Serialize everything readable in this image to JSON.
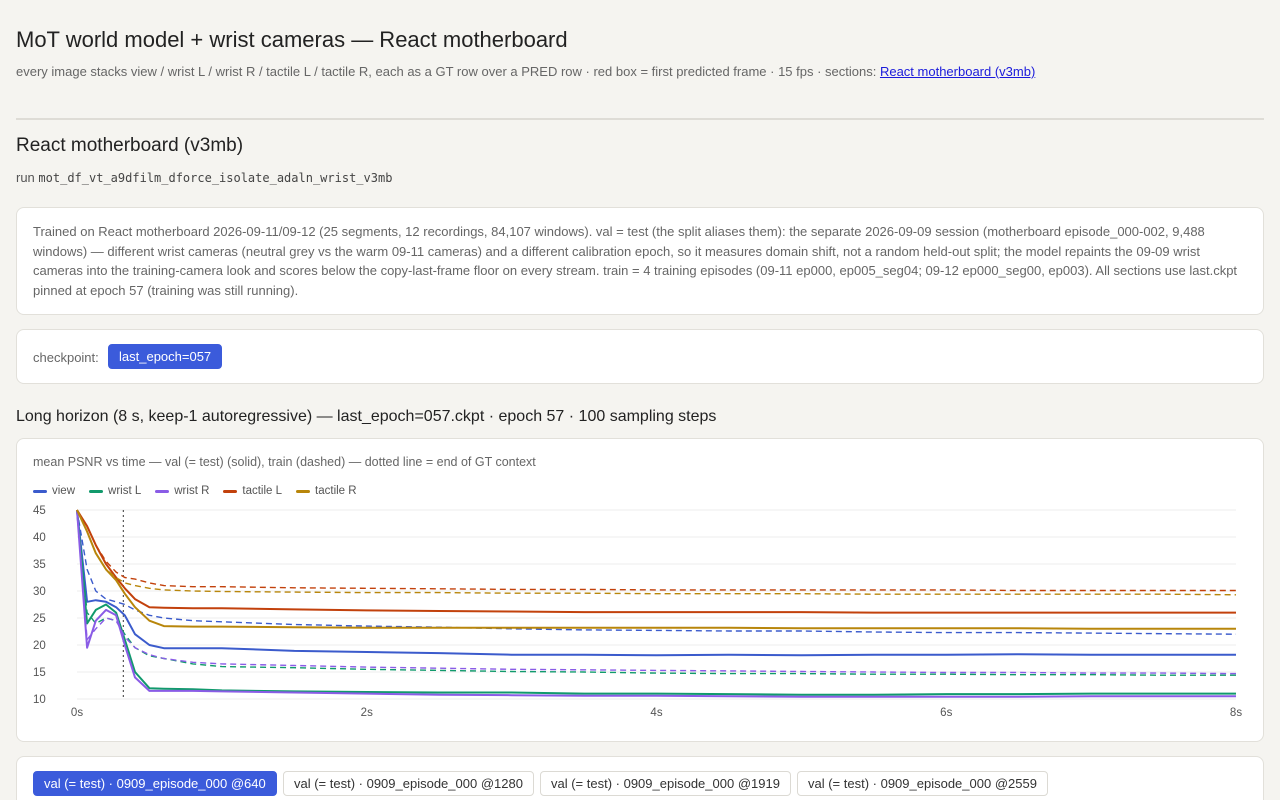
{
  "header": {
    "title": "MoT world model + wrist cameras — React motherboard",
    "subtitle_prefix": "every image stacks view / wrist L / wrist R / tactile L / tactile R, each as a GT row over a PRED row · red box = first predicted frame · 15 fps · sections: ",
    "sections_link": "React motherboard (v3mb)"
  },
  "section": {
    "title": "React motherboard (v3mb)",
    "run_prefix": "run",
    "run_name": "mot_df_vt_a9dfilm_dforce_isolate_adaln_wrist_v3mb",
    "description": "Trained on React motherboard 2026-09-11/09-12 (25 segments, 12 recordings, 84,107 windows). val = test (the split aliases them): the separate 2026-09-09 session (motherboard episode_000-002, 9,488 windows) — different wrist cameras (neutral grey vs the warm 09-11 cameras) and a different calibration epoch, so it measures domain shift, not a random held-out split; the model repaints the 09-09 wrist cameras into the training-camera look and scores below the copy-last-frame floor on every stream. train = 4 training episodes (09-11 ep000, ep005_seg04; 09-12 ep000_seg00, ep003). All sections use last.ckpt pinned at epoch 57 (training was still running).",
    "checkpoint_label": "checkpoint:",
    "checkpoint_value": "last_epoch=057",
    "horizon_title": "Long horizon (8 s, keep-1 autoregressive) — last_epoch=057.ckpt · epoch 57 · 100 sampling steps"
  },
  "chart_title": "mean PSNR vs time — val (= test) (solid), train (dashed) — dotted line = end of GT context",
  "chart_data": {
    "type": "line",
    "title": "mean PSNR vs time — val (= test) (solid), train (dashed) — dotted line = end of GT context",
    "xlabel": "",
    "ylabel": "",
    "xlim": [
      0,
      8
    ],
    "ylim": [
      10,
      45
    ],
    "x_ticks": [
      "0s",
      "2s",
      "4s",
      "6s",
      "8s"
    ],
    "y_ticks": [
      10,
      15,
      20,
      25,
      30,
      35,
      40,
      45
    ],
    "context_end_s": 0.32,
    "grid": true,
    "legend_position": "top-left",
    "x": [
      0,
      0.07,
      0.13,
      0.2,
      0.27,
      0.33,
      0.4,
      0.5,
      0.6,
      0.8,
      1,
      1.5,
      2,
      2.5,
      3,
      3.5,
      4,
      4.5,
      5,
      5.5,
      6,
      6.5,
      7,
      7.5,
      8
    ],
    "series": [
      {
        "name": "view",
        "color": "#3b5bcc",
        "split": "val",
        "values": [
          45,
          28,
          28.3,
          28,
          27,
          25.5,
          22,
          20,
          19.4,
          19.4,
          19.4,
          18.9,
          18.7,
          18.5,
          18.2,
          18.2,
          18.1,
          18.2,
          18.1,
          18.2,
          18.2,
          18.3,
          18.2,
          18.2,
          18.2
        ]
      },
      {
        "name": "view",
        "color": "#3b5bcc",
        "split": "train",
        "values": [
          45,
          34,
          30,
          28.5,
          28,
          27.5,
          26.5,
          25.5,
          25,
          24.5,
          24.3,
          23.8,
          23.5,
          23.3,
          23,
          22.8,
          22.7,
          22.6,
          22.6,
          22.4,
          22.3,
          22.3,
          22.2,
          22.1,
          22
        ]
      },
      {
        "name": "wrist L",
        "color": "#119a6c",
        "split": "val",
        "values": [
          45,
          24,
          26.5,
          27.5,
          26,
          21,
          15,
          12,
          11.9,
          11.8,
          11.6,
          11.4,
          11.3,
          11.2,
          11.2,
          11,
          11,
          10.9,
          10.8,
          10.8,
          10.9,
          10.9,
          11,
          11,
          11
        ]
      },
      {
        "name": "wrist L",
        "color": "#119a6c",
        "split": "train",
        "values": [
          45,
          26,
          24,
          25,
          24.5,
          22,
          19.5,
          18,
          17.5,
          16.5,
          16,
          15.8,
          15.5,
          15.3,
          15.1,
          15,
          14.8,
          14.7,
          14.7,
          14.6,
          14.6,
          14.5,
          14.5,
          14.4,
          14.4
        ]
      },
      {
        "name": "wrist R",
        "color": "#8a5ce6",
        "split": "val",
        "values": [
          45,
          19.5,
          24.5,
          26.5,
          25.5,
          20,
          14,
          11.5,
          11.5,
          11.5,
          11.4,
          11.2,
          11,
          10.8,
          10.7,
          10.6,
          10.6,
          10.5,
          10.4,
          10.4,
          10.4,
          10.4,
          10.5,
          10.5,
          10.5
        ]
      },
      {
        "name": "wrist R",
        "color": "#8a5ce6",
        "split": "train",
        "values": [
          45,
          21,
          23,
          25,
          24.5,
          21.5,
          19.5,
          18.2,
          17.5,
          16.8,
          16.5,
          16.2,
          15.9,
          15.7,
          15.5,
          15.4,
          15.3,
          15.2,
          15.1,
          15,
          14.9,
          14.9,
          14.8,
          14.8,
          14.7
        ]
      },
      {
        "name": "tactile L",
        "color": "#c2410c",
        "split": "val",
        "values": [
          45,
          42,
          38.5,
          35,
          32.5,
          30.5,
          28.5,
          27,
          26.9,
          26.8,
          26.8,
          26.6,
          26.4,
          26.3,
          26.2,
          26.1,
          26.1,
          26.1,
          26.1,
          26,
          26,
          26,
          26,
          26,
          26
        ]
      },
      {
        "name": "tactile L",
        "color": "#c2410c",
        "split": "train",
        "values": [
          45,
          42,
          38.5,
          35.5,
          33.5,
          32.5,
          32.2,
          31.5,
          31,
          30.8,
          30.8,
          30.6,
          30.5,
          30.4,
          30.3,
          30.3,
          30.2,
          30.2,
          30.2,
          30.2,
          30.2,
          30.1,
          30.1,
          30.1,
          30.1
        ]
      },
      {
        "name": "tactile R",
        "color": "#b8860b",
        "split": "val",
        "values": [
          45,
          41,
          37,
          34,
          32,
          29.5,
          27,
          24.5,
          23.5,
          23.4,
          23.4,
          23.3,
          23.2,
          23.2,
          23.2,
          23.2,
          23.2,
          23.2,
          23.1,
          23.1,
          23.1,
          23.1,
          23,
          23,
          23
        ]
      },
      {
        "name": "tactile R",
        "color": "#b8860b",
        "split": "train",
        "values": [
          45,
          41,
          37,
          34,
          32.5,
          31.5,
          31,
          30.5,
          30.2,
          30,
          29.9,
          29.8,
          29.7,
          29.7,
          29.6,
          29.6,
          29.5,
          29.5,
          29.5,
          29.4,
          29.4,
          29.4,
          29.4,
          29.4,
          29.3
        ]
      }
    ]
  },
  "legend": [
    {
      "name": "view",
      "color": "#3b5bcc"
    },
    {
      "name": "wrist L",
      "color": "#119a6c"
    },
    {
      "name": "wrist R",
      "color": "#8a5ce6"
    },
    {
      "name": "tactile L",
      "color": "#c2410c"
    },
    {
      "name": "tactile R",
      "color": "#b8860b"
    }
  ],
  "sample_tabs": [
    {
      "label": "val (= test) · 0909_episode_000 @640",
      "active": true
    },
    {
      "label": "val (= test) · 0909_episode_000 @1280",
      "active": false
    },
    {
      "label": "val (= test) · 0909_episode_000 @1919",
      "active": false
    },
    {
      "label": "val (= test) · 0909_episode_000 @2559",
      "active": false
    }
  ]
}
